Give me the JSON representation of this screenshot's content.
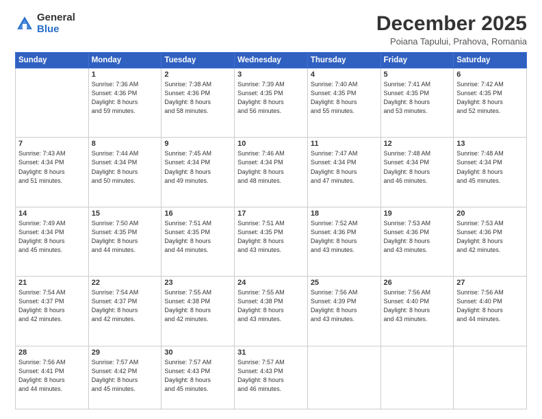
{
  "logo": {
    "general": "General",
    "blue": "Blue"
  },
  "title": "December 2025",
  "location": "Poiana Tapului, Prahova, Romania",
  "weekdays": [
    "Sunday",
    "Monday",
    "Tuesday",
    "Wednesday",
    "Thursday",
    "Friday",
    "Saturday"
  ],
  "weeks": [
    [
      {
        "day": "",
        "info": ""
      },
      {
        "day": "1",
        "info": "Sunrise: 7:36 AM\nSunset: 4:36 PM\nDaylight: 8 hours\nand 59 minutes."
      },
      {
        "day": "2",
        "info": "Sunrise: 7:38 AM\nSunset: 4:36 PM\nDaylight: 8 hours\nand 58 minutes."
      },
      {
        "day": "3",
        "info": "Sunrise: 7:39 AM\nSunset: 4:35 PM\nDaylight: 8 hours\nand 56 minutes."
      },
      {
        "day": "4",
        "info": "Sunrise: 7:40 AM\nSunset: 4:35 PM\nDaylight: 8 hours\nand 55 minutes."
      },
      {
        "day": "5",
        "info": "Sunrise: 7:41 AM\nSunset: 4:35 PM\nDaylight: 8 hours\nand 53 minutes."
      },
      {
        "day": "6",
        "info": "Sunrise: 7:42 AM\nSunset: 4:35 PM\nDaylight: 8 hours\nand 52 minutes."
      }
    ],
    [
      {
        "day": "7",
        "info": "Sunrise: 7:43 AM\nSunset: 4:34 PM\nDaylight: 8 hours\nand 51 minutes."
      },
      {
        "day": "8",
        "info": "Sunrise: 7:44 AM\nSunset: 4:34 PM\nDaylight: 8 hours\nand 50 minutes."
      },
      {
        "day": "9",
        "info": "Sunrise: 7:45 AM\nSunset: 4:34 PM\nDaylight: 8 hours\nand 49 minutes."
      },
      {
        "day": "10",
        "info": "Sunrise: 7:46 AM\nSunset: 4:34 PM\nDaylight: 8 hours\nand 48 minutes."
      },
      {
        "day": "11",
        "info": "Sunrise: 7:47 AM\nSunset: 4:34 PM\nDaylight: 8 hours\nand 47 minutes."
      },
      {
        "day": "12",
        "info": "Sunrise: 7:48 AM\nSunset: 4:34 PM\nDaylight: 8 hours\nand 46 minutes."
      },
      {
        "day": "13",
        "info": "Sunrise: 7:48 AM\nSunset: 4:34 PM\nDaylight: 8 hours\nand 45 minutes."
      }
    ],
    [
      {
        "day": "14",
        "info": "Sunrise: 7:49 AM\nSunset: 4:34 PM\nDaylight: 8 hours\nand 45 minutes."
      },
      {
        "day": "15",
        "info": "Sunrise: 7:50 AM\nSunset: 4:35 PM\nDaylight: 8 hours\nand 44 minutes."
      },
      {
        "day": "16",
        "info": "Sunrise: 7:51 AM\nSunset: 4:35 PM\nDaylight: 8 hours\nand 44 minutes."
      },
      {
        "day": "17",
        "info": "Sunrise: 7:51 AM\nSunset: 4:35 PM\nDaylight: 8 hours\nand 43 minutes."
      },
      {
        "day": "18",
        "info": "Sunrise: 7:52 AM\nSunset: 4:36 PM\nDaylight: 8 hours\nand 43 minutes."
      },
      {
        "day": "19",
        "info": "Sunrise: 7:53 AM\nSunset: 4:36 PM\nDaylight: 8 hours\nand 43 minutes."
      },
      {
        "day": "20",
        "info": "Sunrise: 7:53 AM\nSunset: 4:36 PM\nDaylight: 8 hours\nand 42 minutes."
      }
    ],
    [
      {
        "day": "21",
        "info": "Sunrise: 7:54 AM\nSunset: 4:37 PM\nDaylight: 8 hours\nand 42 minutes."
      },
      {
        "day": "22",
        "info": "Sunrise: 7:54 AM\nSunset: 4:37 PM\nDaylight: 8 hours\nand 42 minutes."
      },
      {
        "day": "23",
        "info": "Sunrise: 7:55 AM\nSunset: 4:38 PM\nDaylight: 8 hours\nand 42 minutes."
      },
      {
        "day": "24",
        "info": "Sunrise: 7:55 AM\nSunset: 4:38 PM\nDaylight: 8 hours\nand 43 minutes."
      },
      {
        "day": "25",
        "info": "Sunrise: 7:56 AM\nSunset: 4:39 PM\nDaylight: 8 hours\nand 43 minutes."
      },
      {
        "day": "26",
        "info": "Sunrise: 7:56 AM\nSunset: 4:40 PM\nDaylight: 8 hours\nand 43 minutes."
      },
      {
        "day": "27",
        "info": "Sunrise: 7:56 AM\nSunset: 4:40 PM\nDaylight: 8 hours\nand 44 minutes."
      }
    ],
    [
      {
        "day": "28",
        "info": "Sunrise: 7:56 AM\nSunset: 4:41 PM\nDaylight: 8 hours\nand 44 minutes."
      },
      {
        "day": "29",
        "info": "Sunrise: 7:57 AM\nSunset: 4:42 PM\nDaylight: 8 hours\nand 45 minutes."
      },
      {
        "day": "30",
        "info": "Sunrise: 7:57 AM\nSunset: 4:43 PM\nDaylight: 8 hours\nand 45 minutes."
      },
      {
        "day": "31",
        "info": "Sunrise: 7:57 AM\nSunset: 4:43 PM\nDaylight: 8 hours\nand 46 minutes."
      },
      {
        "day": "",
        "info": ""
      },
      {
        "day": "",
        "info": ""
      },
      {
        "day": "",
        "info": ""
      }
    ]
  ]
}
